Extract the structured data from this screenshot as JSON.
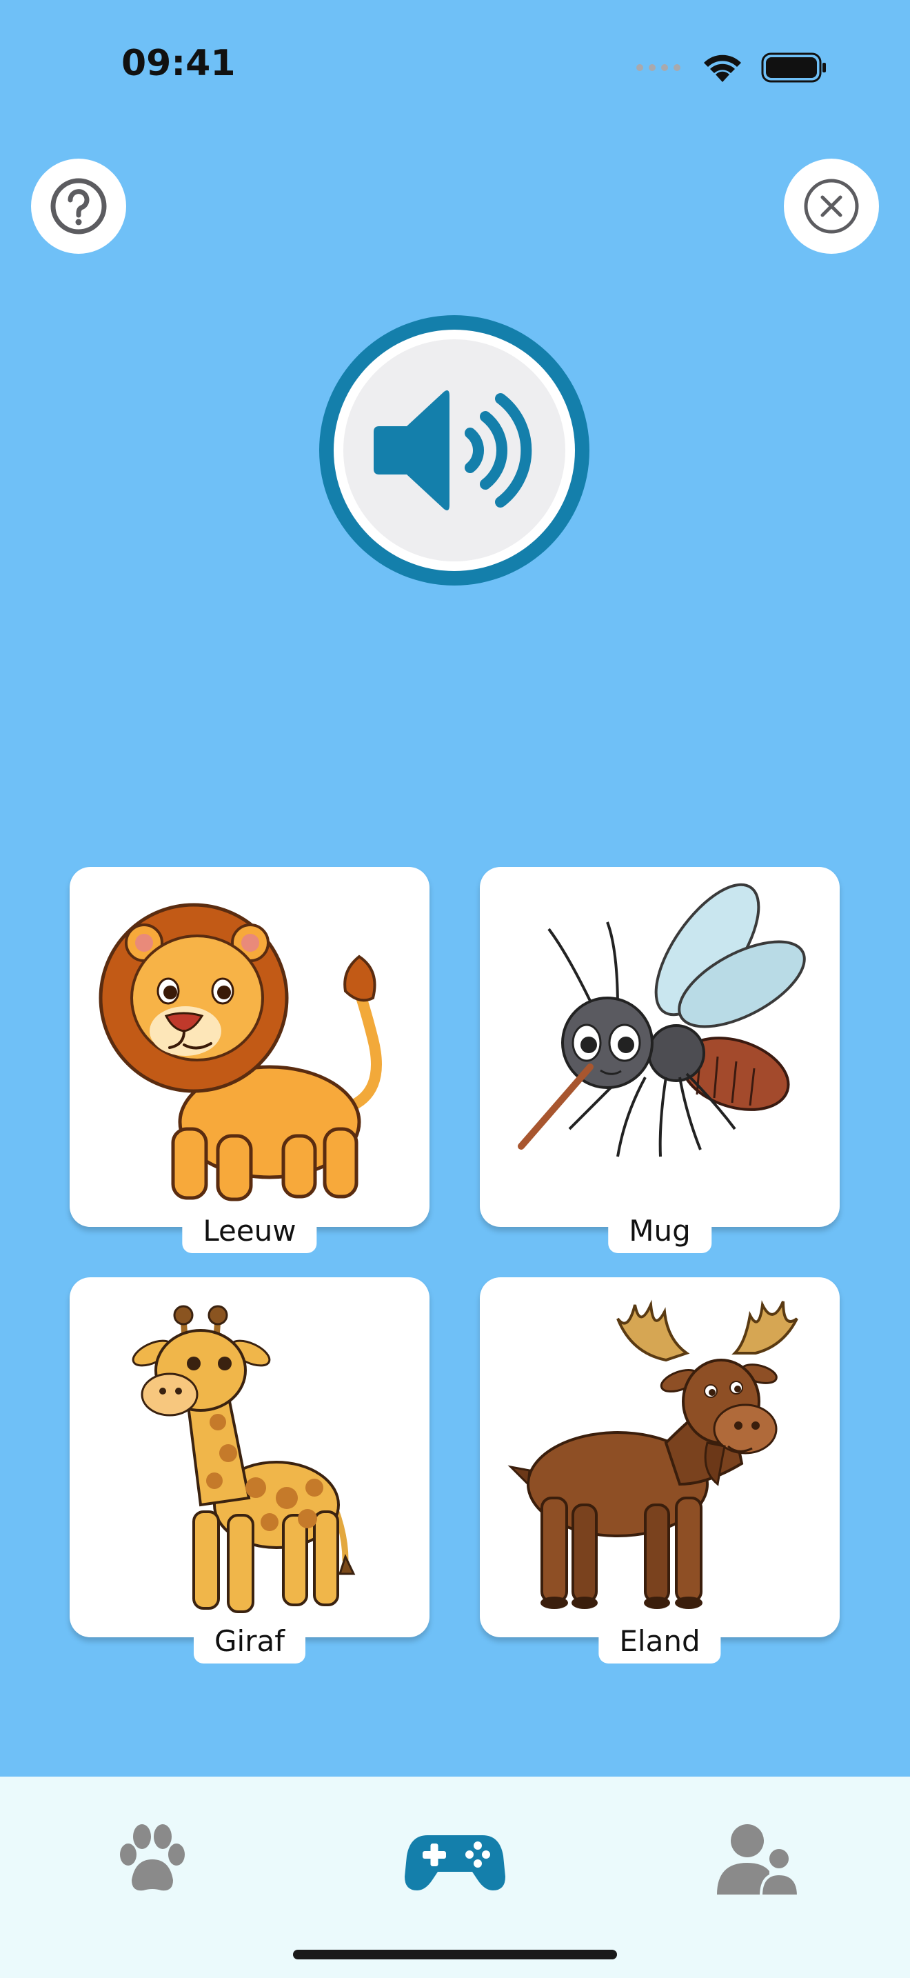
{
  "status_bar": {
    "time": "09:41",
    "icons": [
      "signal-icon",
      "wifi-icon",
      "battery-icon"
    ]
  },
  "top_buttons": {
    "help_icon": "question-circle-icon",
    "close_icon": "close-circle-icon"
  },
  "sound_button": {
    "icon": "speaker-volume-icon"
  },
  "answers": [
    {
      "label": "Leeuw",
      "icon": "lion-illustration"
    },
    {
      "label": "Mug",
      "icon": "mosquito-illustration"
    },
    {
      "label": "Giraf",
      "icon": "giraffe-illustration"
    },
    {
      "label": "Eland",
      "icon": "moose-illustration"
    }
  ],
  "tabbar": {
    "tabs": [
      {
        "icon": "paw-icon",
        "active": false
      },
      {
        "icon": "gamepad-icon",
        "active": true
      },
      {
        "icon": "users-icon",
        "active": false
      }
    ]
  },
  "colors": {
    "background": "#6fc0f7",
    "accent": "#147fab",
    "tabbar_background": "#ebfafc",
    "inactive_icon": "#8a8a8a",
    "card": "#ffffff"
  }
}
